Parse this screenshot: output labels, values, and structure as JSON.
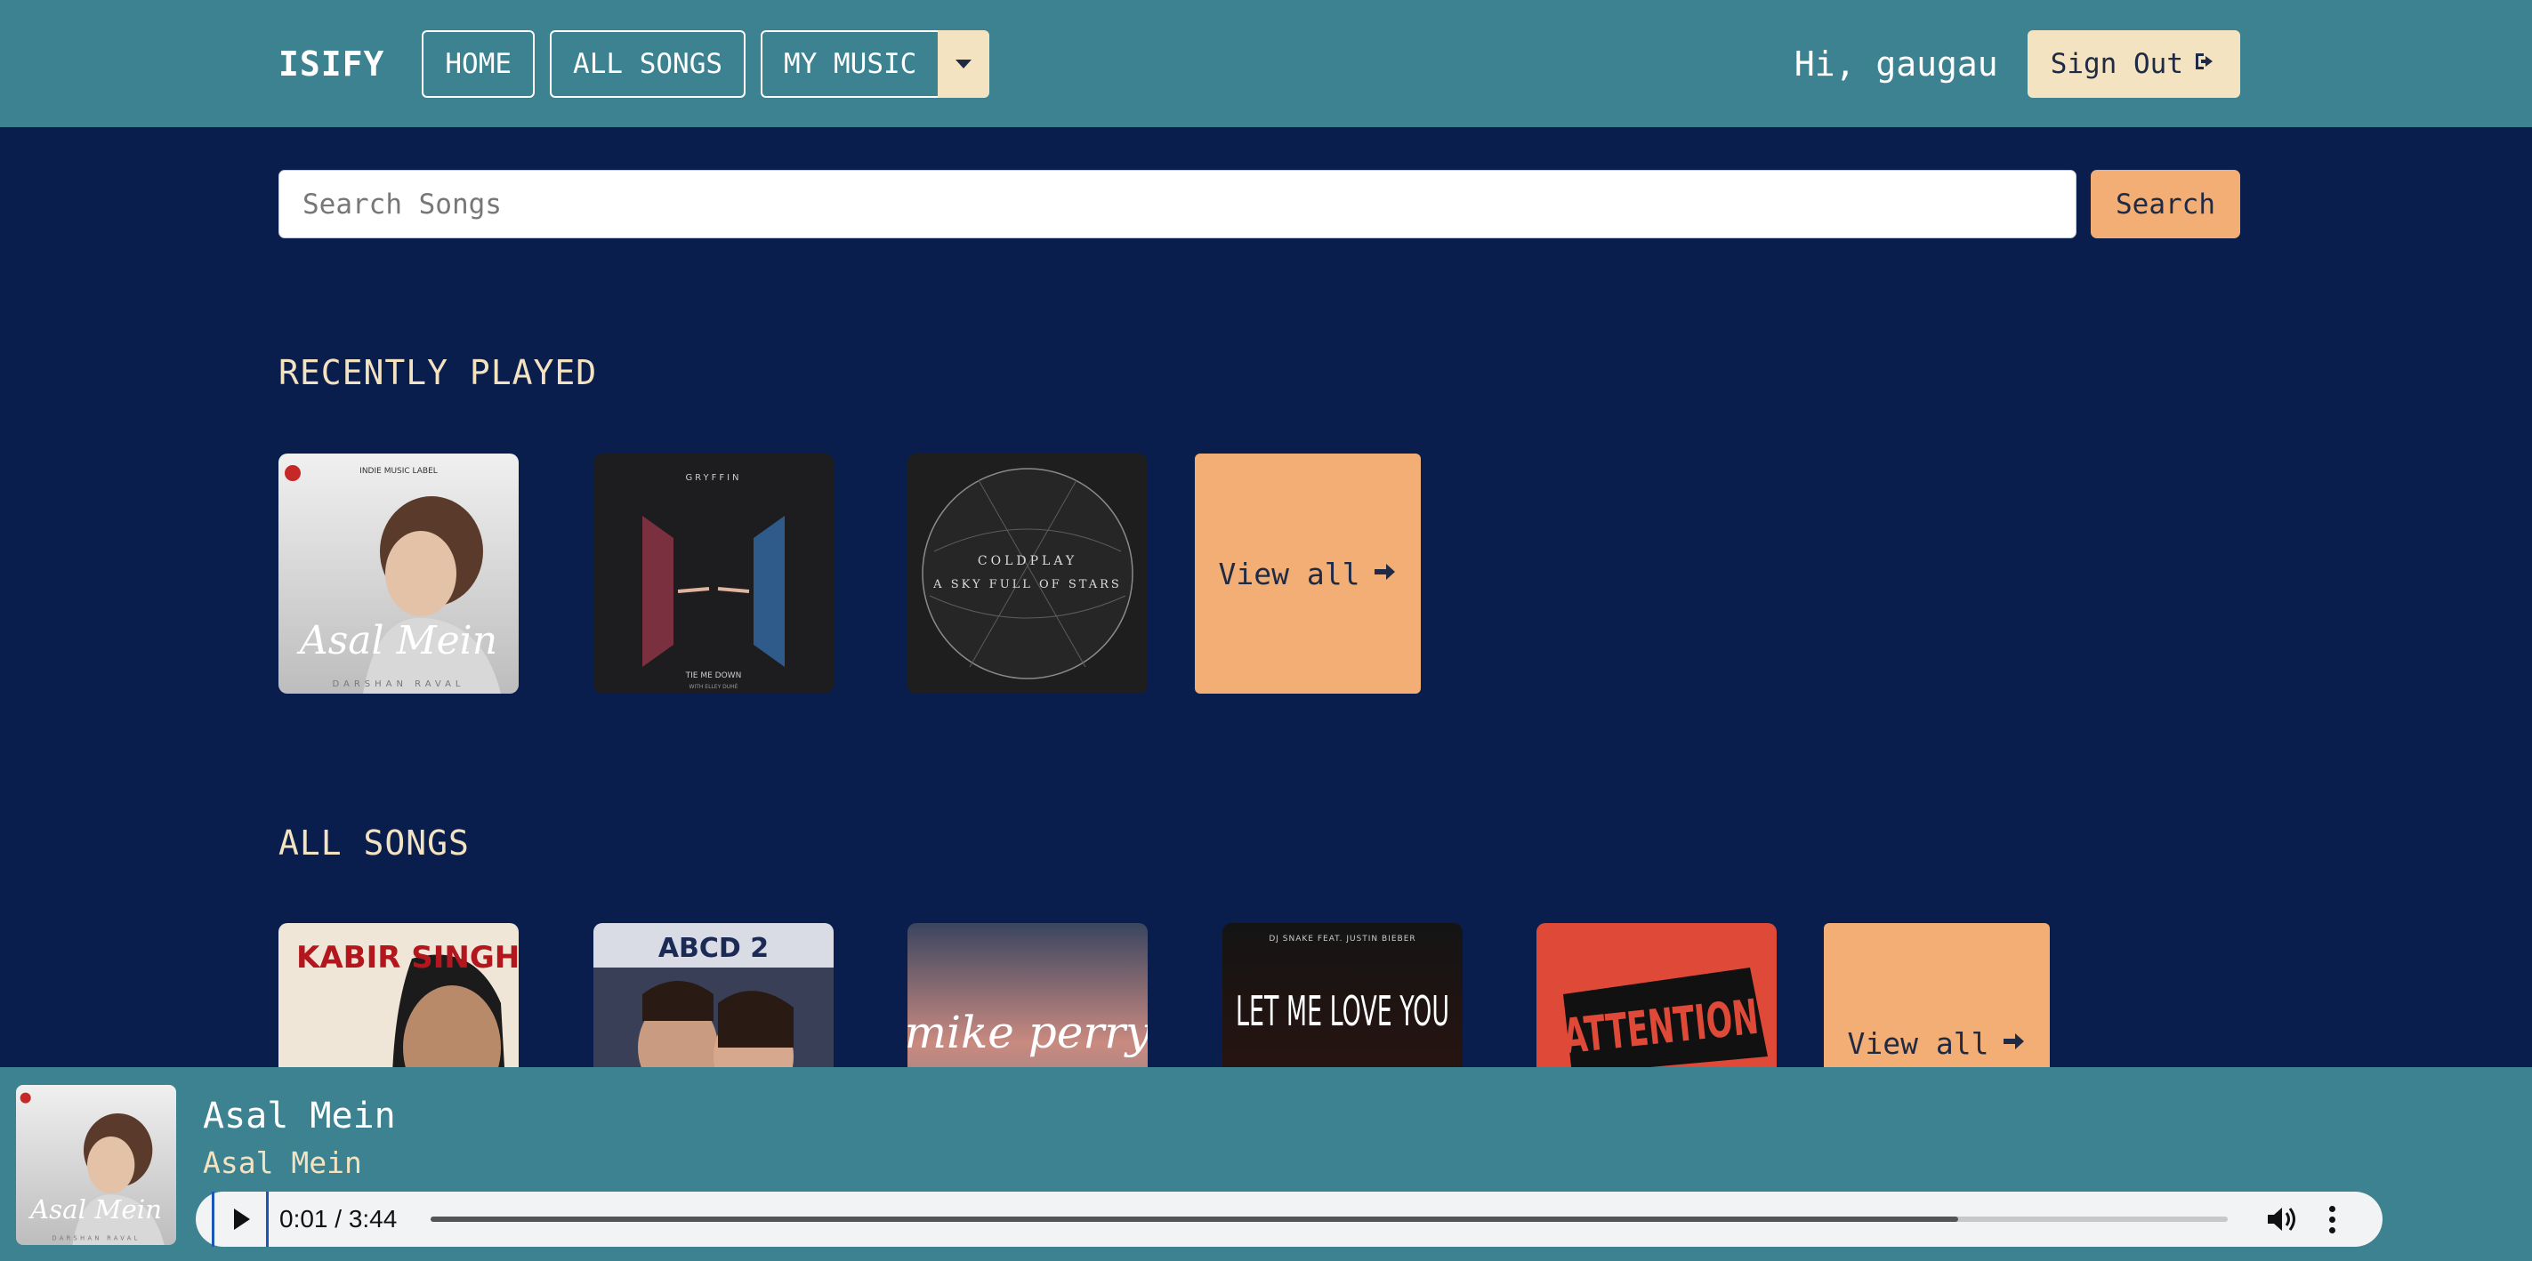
{
  "navbar": {
    "brand": "ISIFY",
    "home_label": "HOME",
    "all_songs_label": "ALL SONGS",
    "my_music_label": "MY MUSIC",
    "greeting": "Hi, gaugau",
    "signout_label": "Sign Out",
    "signout_icon": "sign-out-icon"
  },
  "search": {
    "placeholder": "Search Songs",
    "button_label": "Search"
  },
  "recently_played": {
    "title": "RECENTLY PLAYED",
    "covers": [
      {
        "label_top": "INDIE MUSIC LABEL",
        "title": "Asal Mein",
        "artist": "DARSHAN RAVAL"
      },
      {
        "label_top": "GRYFFIN",
        "title": "TIE ME DOWN",
        "artist": "WITH ELLEY DUHÉ"
      },
      {
        "label_top": "COLDPLAY",
        "title": "A SKY FULL OF STARS"
      }
    ],
    "view_all_label": "View all"
  },
  "all_songs": {
    "title": "ALL SONGS",
    "covers": [
      {
        "title": "KABIR SINGH"
      },
      {
        "title": "ABCD 2"
      },
      {
        "title": "mike perry"
      },
      {
        "label_top": "DJ SNAKE   FEAT. JUSTIN BIEBER",
        "title": "LET ME LOVE YOU"
      },
      {
        "title": "ATTENTION"
      }
    ],
    "view_all_label": "View all"
  },
  "player": {
    "title": "Asal Mein",
    "artist": "Asal Mein",
    "time": "0:01 / 3:44",
    "progress_fraction": 0.85
  },
  "colors": {
    "navbar": "#3c8290",
    "background": "#0a1e4e",
    "accent": "#f2ae74",
    "cream": "#f4e3c1"
  }
}
